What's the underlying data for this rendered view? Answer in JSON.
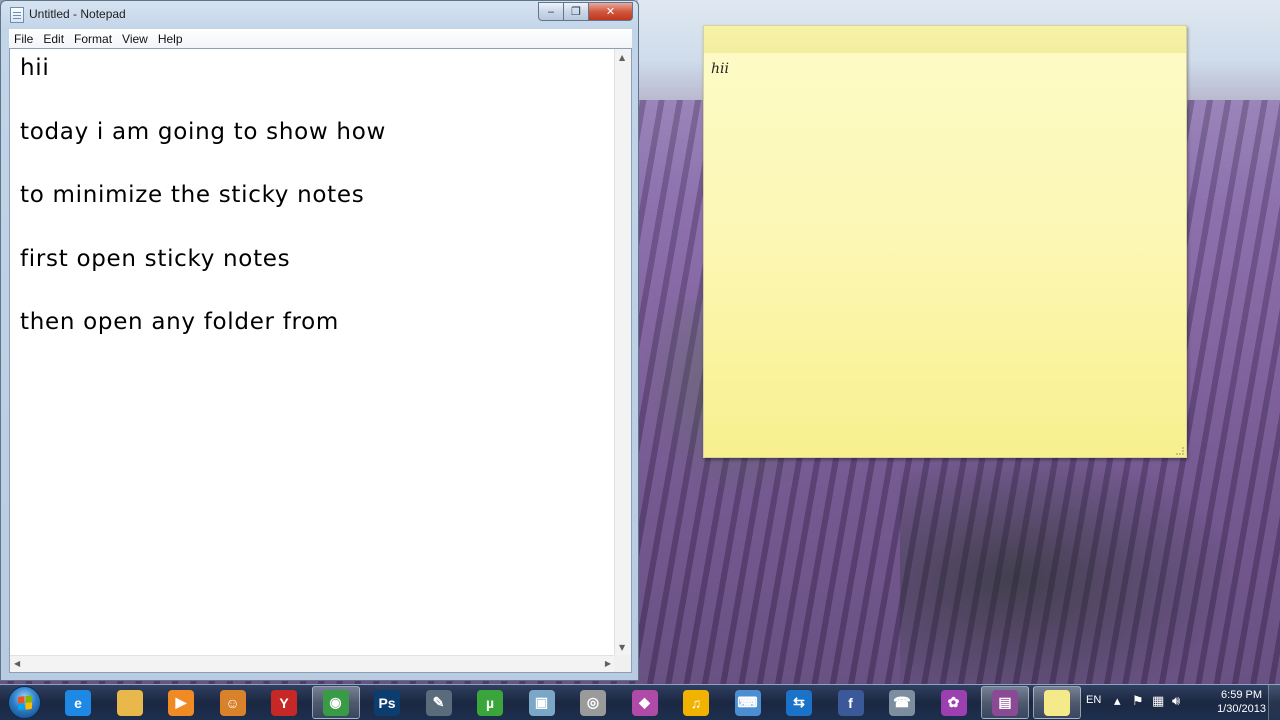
{
  "notepad": {
    "title": "Untitled - Notepad",
    "controls": {
      "minimize": "‒",
      "maximize": "❐",
      "close": "✕"
    },
    "menu": [
      "File",
      "Edit",
      "Format",
      "View",
      "Help"
    ],
    "content": "hii\n\ntoday i am going to show how\n\nto minimize the sticky notes\n\nfirst open sticky notes\n\nthen open any folder from"
  },
  "sticky_note": {
    "text": "hii",
    "color": "#fcf7b4"
  },
  "taskbar": {
    "pinned": [
      {
        "name": "internet-explorer-icon",
        "glyph": "e",
        "color": "#1e88e5"
      },
      {
        "name": "windows-explorer-icon",
        "glyph": "",
        "color": "#e8b84a"
      },
      {
        "name": "media-player-icon",
        "glyph": "▶",
        "color": "#f08a24"
      },
      {
        "name": "cartoon-face-icon",
        "glyph": "☺",
        "color": "#d9822b"
      },
      {
        "name": "yahoo-messenger-icon",
        "glyph": "Y",
        "color": "#c62828"
      },
      {
        "name": "chrome-icon",
        "glyph": "◉",
        "color": "#3a9b47"
      },
      {
        "name": "photoshop-icon",
        "glyph": "Ps",
        "color": "#0b3e6f"
      },
      {
        "name": "tools-icon",
        "glyph": "✎",
        "color": "#5a6b7c"
      },
      {
        "name": "utorrent-icon",
        "glyph": "µ",
        "color": "#3aa53a"
      },
      {
        "name": "virtualbox-icon",
        "glyph": "▣",
        "color": "#7aa7c7"
      },
      {
        "name": "webcam-icon",
        "glyph": "◎",
        "color": "#9a9a9a"
      },
      {
        "name": "media-app-icon",
        "glyph": "◆",
        "color": "#b04aa8"
      },
      {
        "name": "headphones-icon",
        "glyph": "♫",
        "color": "#f2b200"
      },
      {
        "name": "keyboard-icon",
        "glyph": "⌨",
        "color": "#4b8ed1"
      },
      {
        "name": "teamviewer-icon",
        "glyph": "⇆",
        "color": "#1a73c8"
      },
      {
        "name": "facebook-icon",
        "glyph": "f",
        "color": "#3b5998"
      },
      {
        "name": "phone-icon",
        "glyph": "☎",
        "color": "#7d8f9f"
      },
      {
        "name": "picasa-icon",
        "glyph": "✿",
        "color": "#9c3fb0"
      },
      {
        "name": "video-app-icon",
        "glyph": "▤",
        "color": "#8a4a94"
      },
      {
        "name": "sticky-notes-icon",
        "glyph": "",
        "color": "#f4ea8a"
      }
    ],
    "language": "EN",
    "clock": {
      "time": "6:59 PM",
      "date": "1/30/2013"
    }
  }
}
